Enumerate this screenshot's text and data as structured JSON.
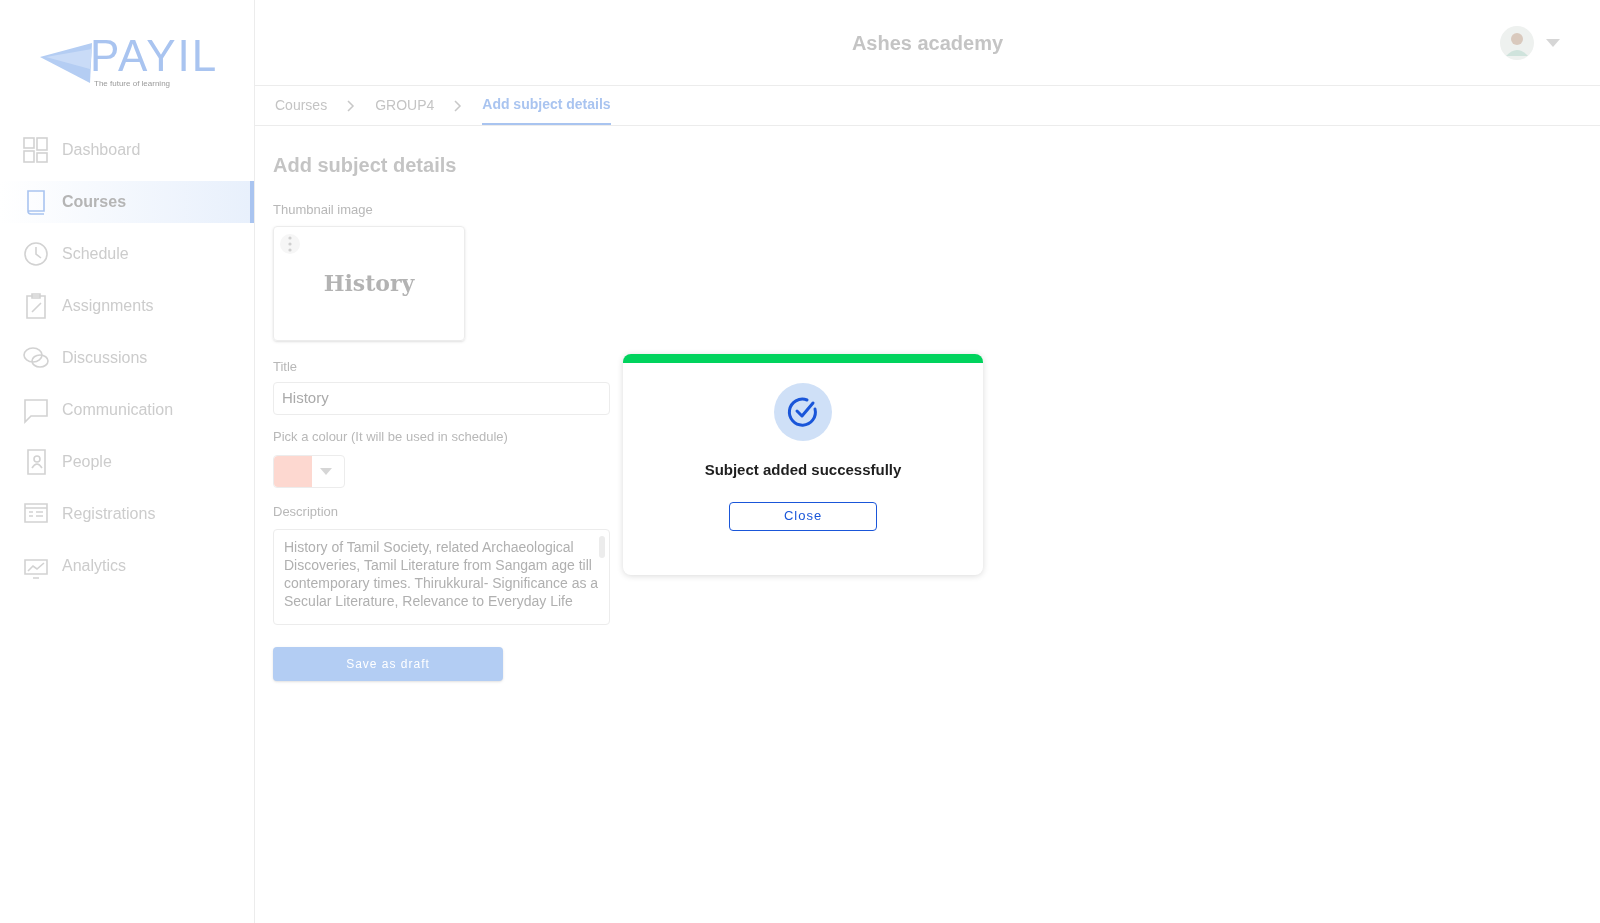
{
  "logo": {
    "name": "PAYIL",
    "tagline": "The future of learning"
  },
  "sidebar": {
    "items": [
      {
        "label": "Dashboard",
        "selected": false
      },
      {
        "label": "Courses",
        "selected": true
      },
      {
        "label": "Schedule",
        "selected": false
      },
      {
        "label": "Assignments",
        "selected": false
      },
      {
        "label": "Discussions",
        "selected": false
      },
      {
        "label": "Communication",
        "selected": false
      },
      {
        "label": "People",
        "selected": false
      },
      {
        "label": "Registrations",
        "selected": false
      },
      {
        "label": "Analytics",
        "selected": false
      }
    ]
  },
  "header": {
    "title": "Ashes academy"
  },
  "breadcrumbs": [
    {
      "label": "Courses",
      "selected": false
    },
    {
      "label": "GROUP4",
      "selected": false
    },
    {
      "label": "Add subject details",
      "selected": true
    }
  ],
  "form": {
    "heading": "Add subject details",
    "thumbnail_label": "Thumbnail image",
    "thumbnail_text": "History",
    "title_label": "Title",
    "title_value": "History",
    "colour_label": "Pick a colour (It will be used in schedule)",
    "description_label": "Description",
    "description_value": "History of Tamil Society, related Archaeological Discoveries, Tamil Literature from Sangam age till contemporary times. Thirukkural- Significance as a Secular Literature, Relevance to Everyday Life",
    "save_button": "Save as draft"
  },
  "dialog": {
    "message": "Subject added successfully",
    "close_button": "Close"
  }
}
